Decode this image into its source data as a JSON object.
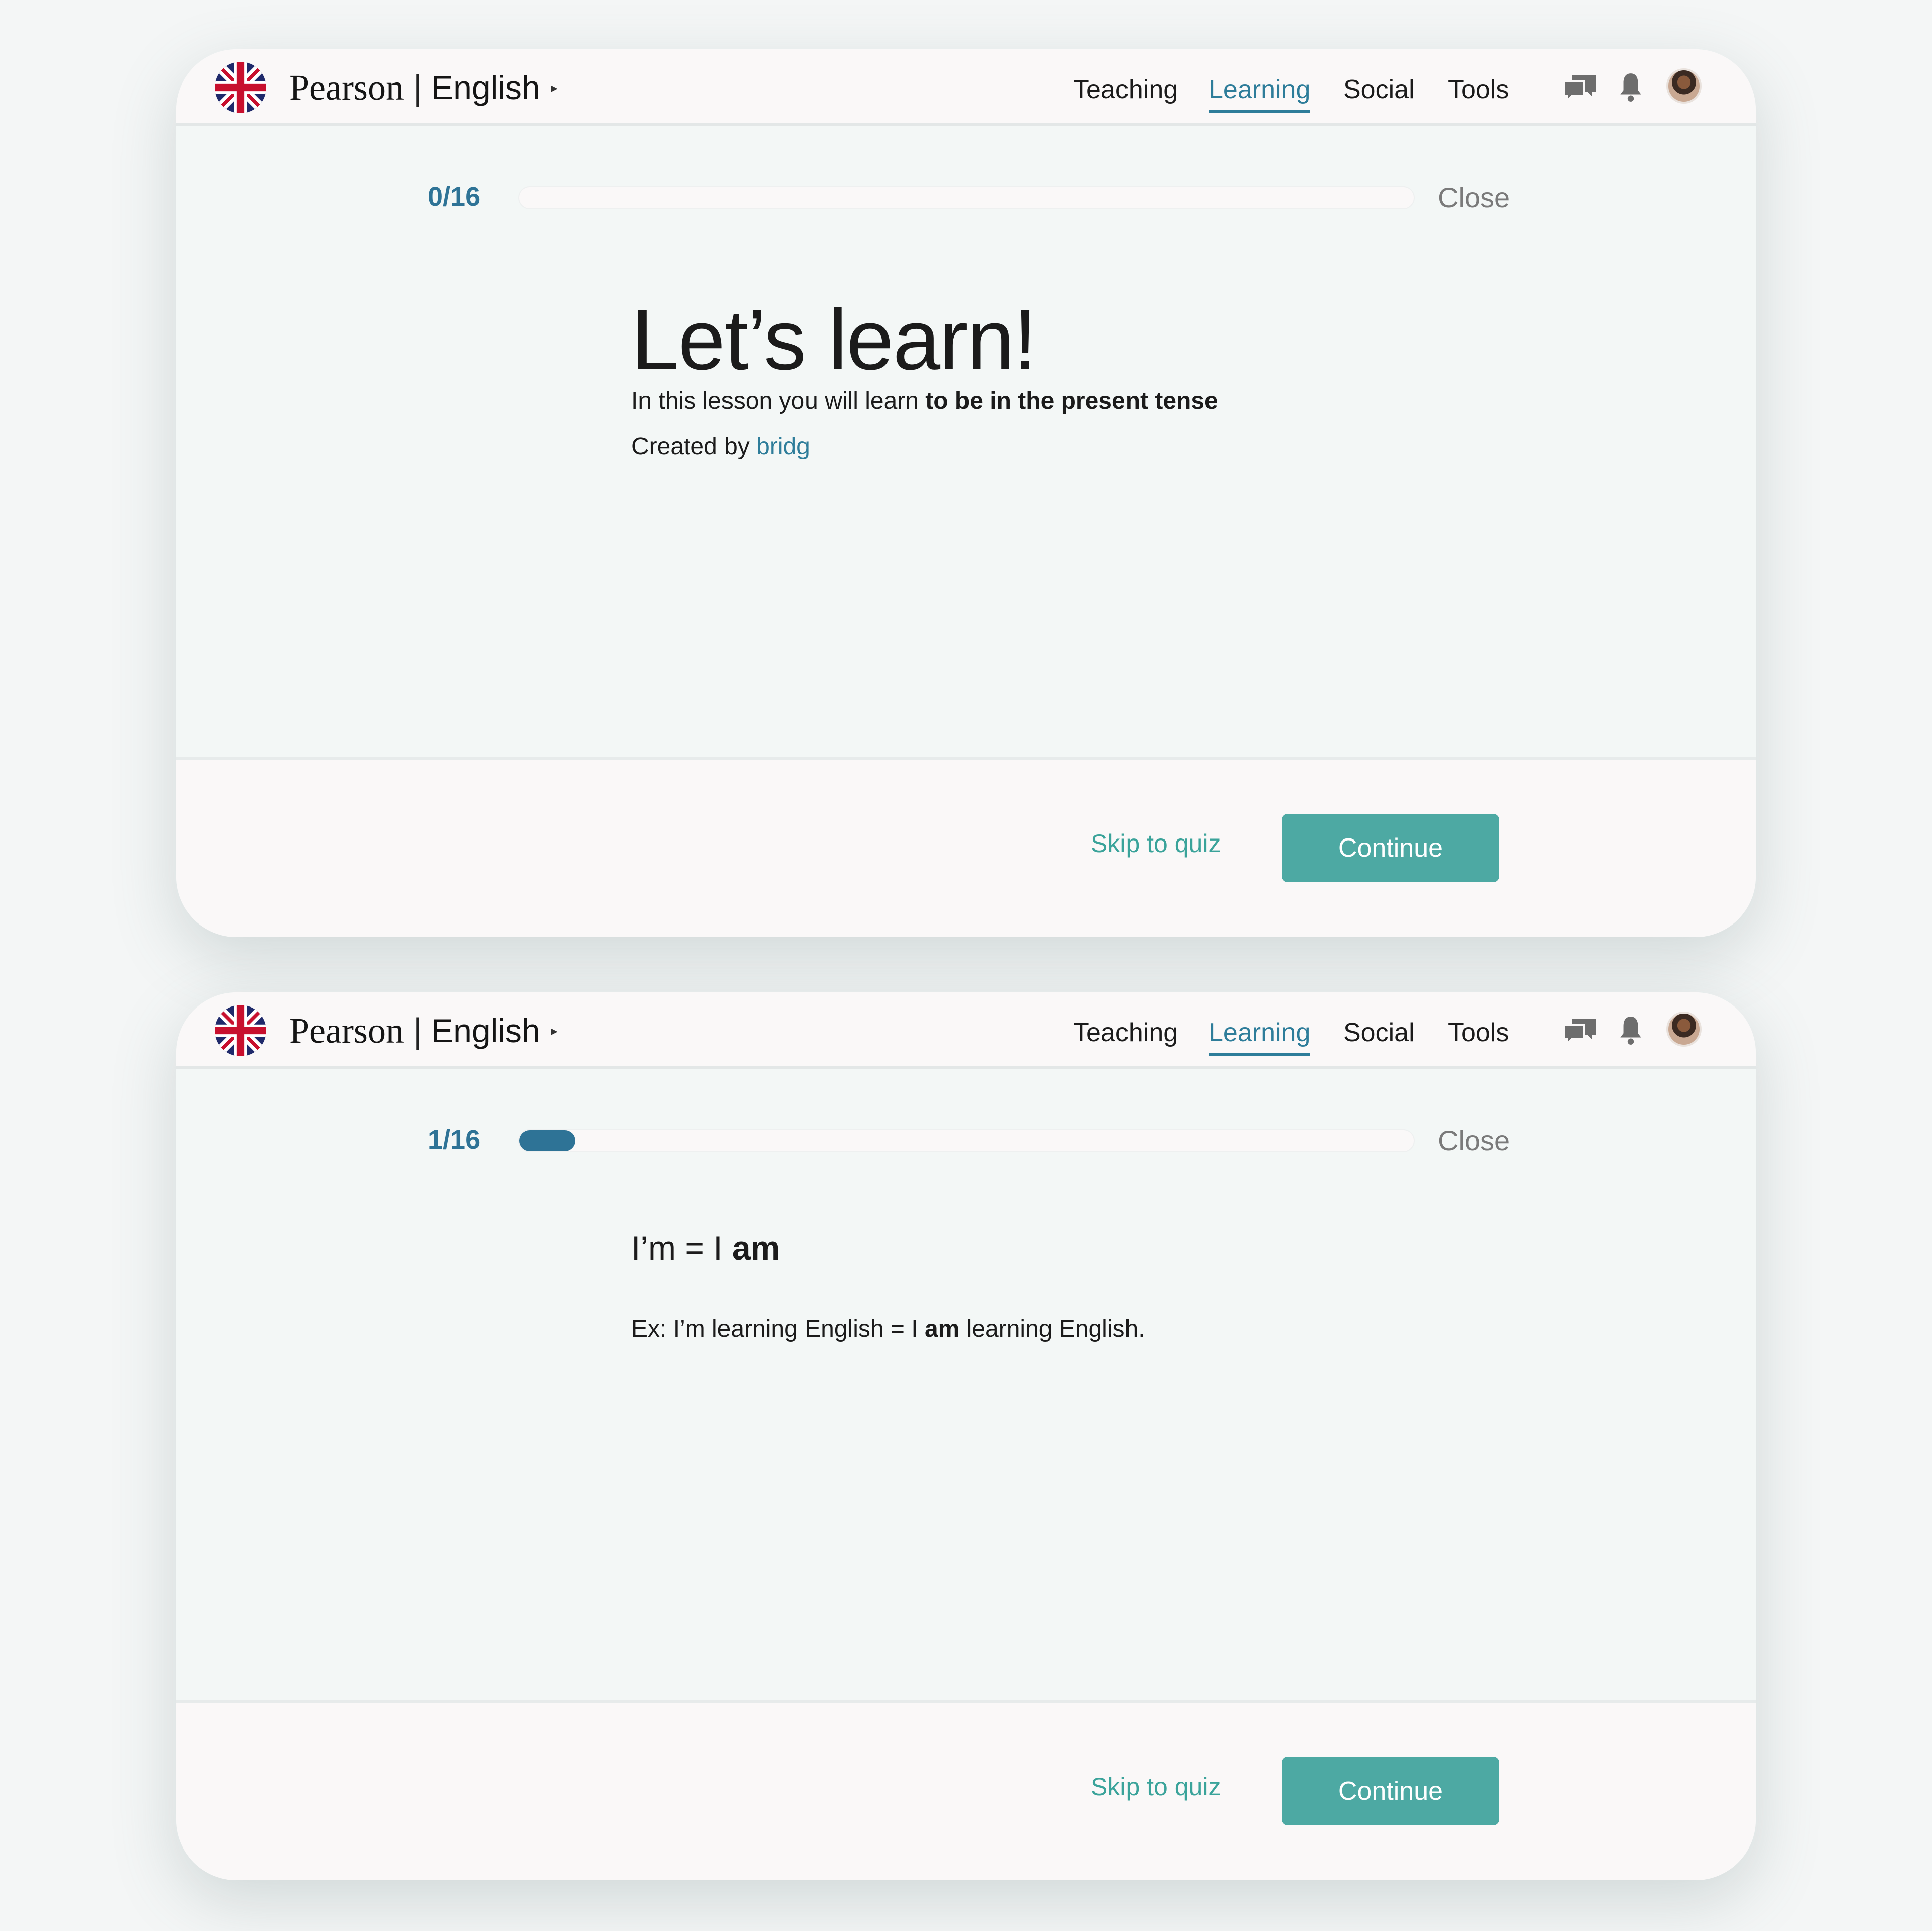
{
  "brand": {
    "name": "Pearson",
    "separator": "|",
    "language": "English",
    "caret": "▸"
  },
  "nav": {
    "items": [
      "Teaching",
      "Learning",
      "Social",
      "Tools"
    ],
    "active": "Learning"
  },
  "colors": {
    "accent": "#2e7396",
    "link": "#2e7d9a",
    "button": "#4da9a3",
    "skip": "#3aa39a"
  },
  "icons": [
    "uk-flag-icon",
    "chat-icon",
    "bell-icon",
    "avatar"
  ],
  "screens": [
    {
      "progress": {
        "label": "0/16",
        "current": 0,
        "total": 16,
        "fraction": 0.0
      },
      "close_label": "Close",
      "title": "Let’s learn!",
      "description_prefix": "In this lesson you will learn ",
      "description_bold": "to be in the present tense",
      "created_prefix": "Created by ",
      "author": "bridg",
      "skip_label": "Skip to quiz",
      "continue_label": "Continue"
    },
    {
      "progress": {
        "label": "1/16",
        "current": 1,
        "total": 16,
        "fraction": 0.0625
      },
      "close_label": "Close",
      "rule_prefix": "I’m = I ",
      "rule_bold": "am",
      "example_prefix": "Ex: I’m learning English = I ",
      "example_bold": "am",
      "example_suffix": " learning English.",
      "skip_label": "Skip to quiz",
      "continue_label": "Continue"
    }
  ]
}
